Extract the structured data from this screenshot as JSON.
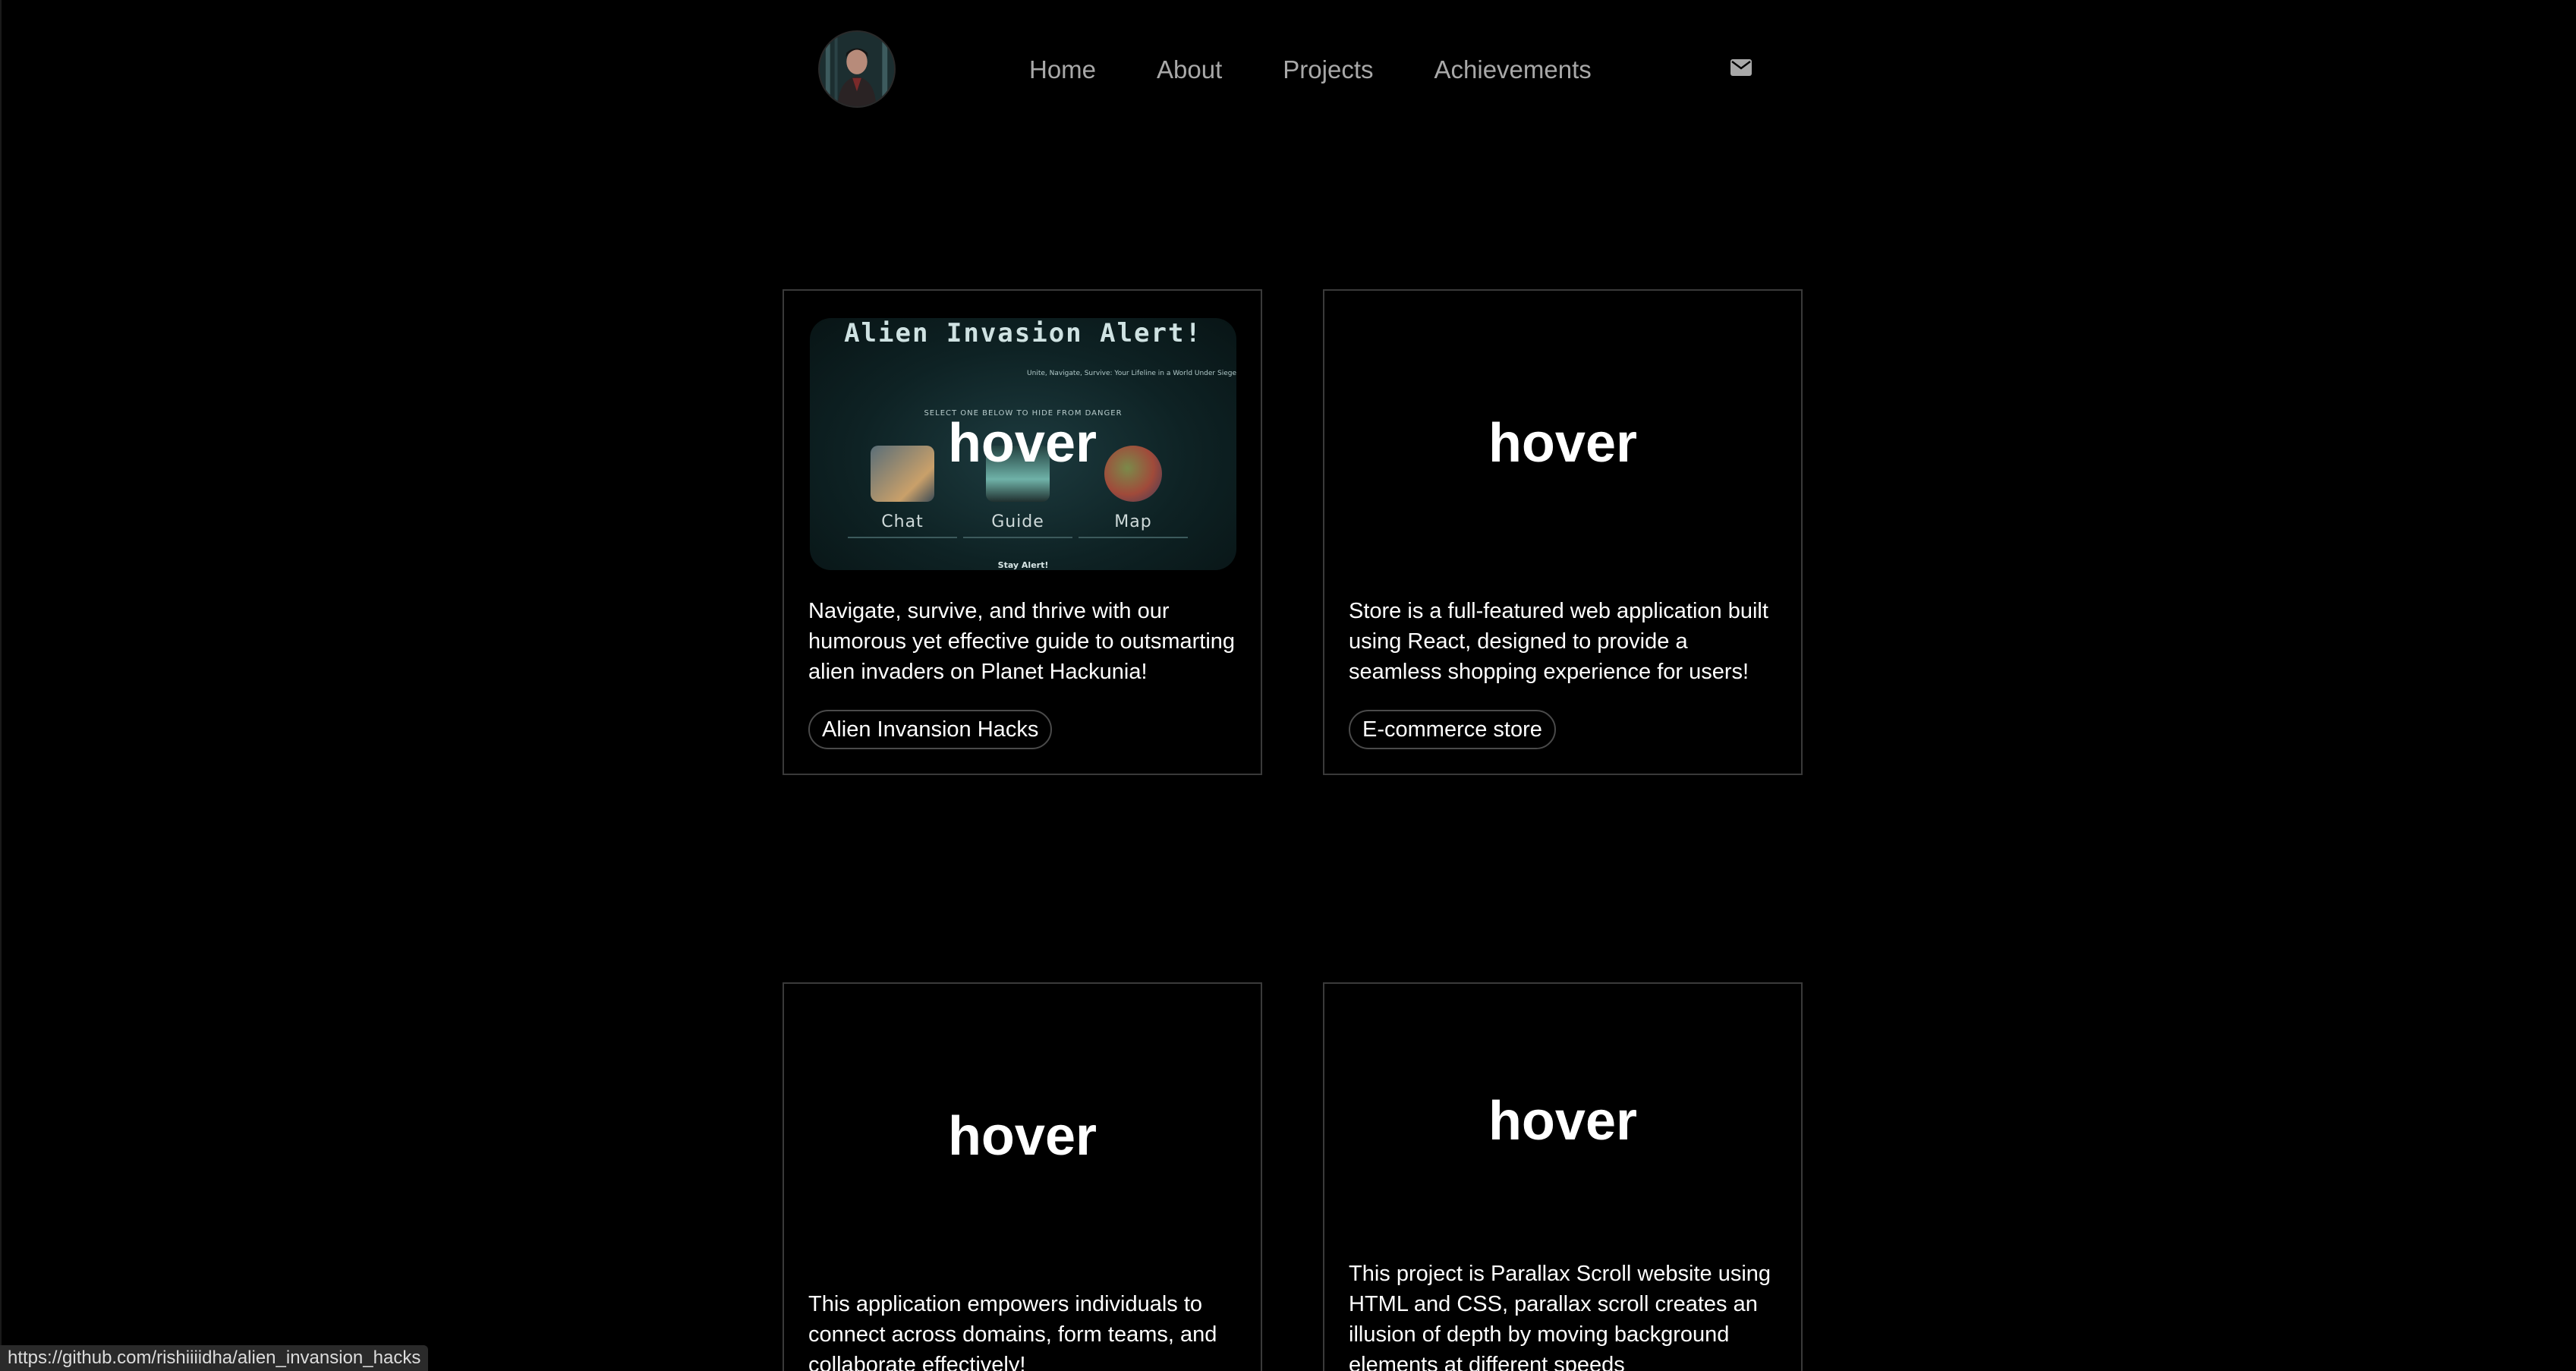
{
  "nav": {
    "items": [
      {
        "label": "Home"
      },
      {
        "label": "About"
      },
      {
        "label": "Projects"
      },
      {
        "label": "Achievements"
      }
    ]
  },
  "colors": {
    "background": "#000000",
    "nav_text": "#a8a8a8",
    "card_border": "#3a3a3a"
  },
  "cards": [
    {
      "overlay": "hover",
      "preview": {
        "title": "Alien Invasion Alert!",
        "subtitle": "Unite, Navigate, Survive: Your Lifeline in a World Under Siege",
        "prompt": "SELECT ONE BELOW TO HIDE FROM DANGER",
        "options": [
          "Chat",
          "Guide",
          "Map"
        ],
        "footer": "Stay Alert!"
      },
      "description": "Navigate, survive, and thrive with our humorous yet effective guide to outsmarting alien invaders on Planet Hackunia!",
      "tag": "Alien Invansion Hacks"
    },
    {
      "overlay": "hover",
      "description": "Store is a full-featured web application built using React, designed to provide a seamless shopping experience for users!",
      "tag": "E-commerce store"
    },
    {
      "overlay": "hover",
      "description": "This application empowers individuals to connect across domains, form teams, and collaborate effectively!"
    },
    {
      "overlay": "hover",
      "description": "This project is Parallax Scroll website using HTML and CSS, parallax scroll creates an illusion of depth by moving background elements at different speeds"
    }
  ],
  "status_bar": {
    "url": "https://github.com/rishiiiidha/alien_invansion_hacks"
  }
}
